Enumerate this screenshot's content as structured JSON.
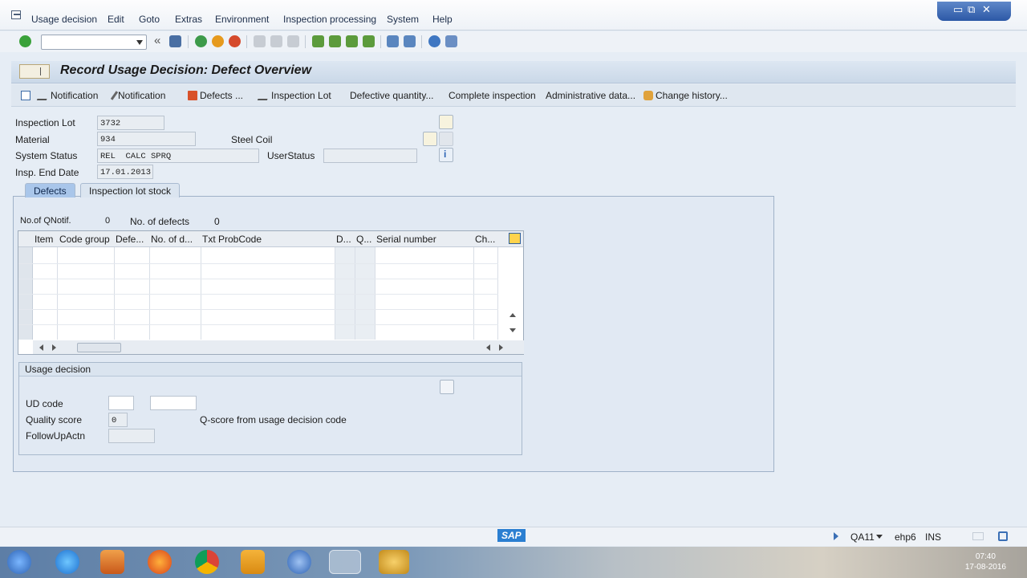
{
  "menu": {
    "items": [
      "Usage decision",
      "Edit",
      "Goto",
      "Extras",
      "Environment",
      "Inspection processing",
      "System",
      "Help"
    ]
  },
  "window_controls": {
    "minimize": "▭",
    "restore": "⧉",
    "close": "✕"
  },
  "toolbar": {
    "command_field_value": ""
  },
  "title": "Record Usage Decision: Defect Overview",
  "app_toolbar": {
    "buttons": [
      "Notification",
      "Notification",
      "Defects ...",
      "Inspection Lot",
      "Defective quantity...",
      "Complete inspection",
      "Administrative data...",
      "Change history..."
    ]
  },
  "header": {
    "inspection_lot_label": "Inspection Lot",
    "inspection_lot_value": "3732",
    "material_label": "Material",
    "material_value": "934",
    "material_desc": "Steel Coil",
    "system_status_label": "System Status",
    "system_status_value": "REL  CALC SPRQ",
    "user_status_label": "UserStatus",
    "user_status_value": "",
    "insp_end_date_label": "Insp. End Date",
    "insp_end_date_value": "17.01.2013"
  },
  "tabs": [
    "Defects",
    "Inspection lot stock"
  ],
  "defects": {
    "qnotif_label": "No.of QNotif.",
    "qnotif_value": "0",
    "defects_label": "No. of defects",
    "defects_value": "0",
    "columns": [
      "Item",
      "Code group",
      "Defe...",
      "No. of d...",
      "Txt ProbCode",
      "D...",
      "Q...",
      "Serial number",
      "Ch..."
    ]
  },
  "usage_decision": {
    "section_title": "Usage decision",
    "ud_code_label": "UD code",
    "ud_code_value": "",
    "ud_code_text": "",
    "quality_score_label": "Quality score",
    "quality_score_value": "0",
    "qscore_note": "Q-score from usage decision code",
    "followup_label": "FollowUpActn",
    "followup_value": ""
  },
  "status_bar": {
    "sap_logo": "SAP",
    "system": "QA11",
    "server": "ehp6",
    "mode": "INS"
  },
  "taskbar": {
    "time": "07:40",
    "date": "17-08-2016"
  },
  "colors": {
    "accent": "#2c58a6",
    "title_bar": "#cad8e8",
    "panel": "#e1e9f3"
  }
}
